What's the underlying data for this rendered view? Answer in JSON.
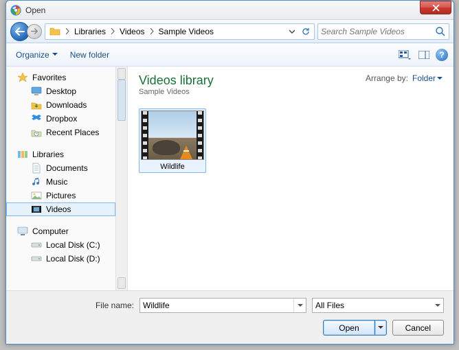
{
  "window": {
    "title": "Open"
  },
  "breadcrumb": {
    "segments": [
      "Libraries",
      "Videos",
      "Sample Videos"
    ]
  },
  "search": {
    "placeholder": "Search Sample Videos"
  },
  "toolbar": {
    "organize_label": "Organize",
    "newfolder_label": "New folder"
  },
  "sidebar": {
    "favorites": {
      "label": "Favorites",
      "items": [
        {
          "label": "Desktop",
          "icon": "desktop"
        },
        {
          "label": "Downloads",
          "icon": "downloads"
        },
        {
          "label": "Dropbox",
          "icon": "dropbox"
        },
        {
          "label": "Recent Places",
          "icon": "recent"
        }
      ]
    },
    "libraries": {
      "label": "Libraries",
      "items": [
        {
          "label": "Documents",
          "icon": "documents"
        },
        {
          "label": "Music",
          "icon": "music"
        },
        {
          "label": "Pictures",
          "icon": "pictures"
        },
        {
          "label": "Videos",
          "icon": "videos",
          "selected": true
        }
      ]
    },
    "computer": {
      "label": "Computer",
      "items": [
        {
          "label": "Local Disk (C:)",
          "icon": "drive"
        },
        {
          "label": "Local Disk (D:)",
          "icon": "drive"
        }
      ]
    }
  },
  "content": {
    "library_title": "Videos library",
    "library_subtitle": "Sample Videos",
    "arrange_label": "Arrange by:",
    "arrange_value": "Folder",
    "items": [
      {
        "label": "Wildlife"
      }
    ]
  },
  "footer": {
    "filename_label": "File name:",
    "filename_value": "Wildlife",
    "filter_label": "All Files",
    "open_label": "Open",
    "cancel_label": "Cancel"
  }
}
